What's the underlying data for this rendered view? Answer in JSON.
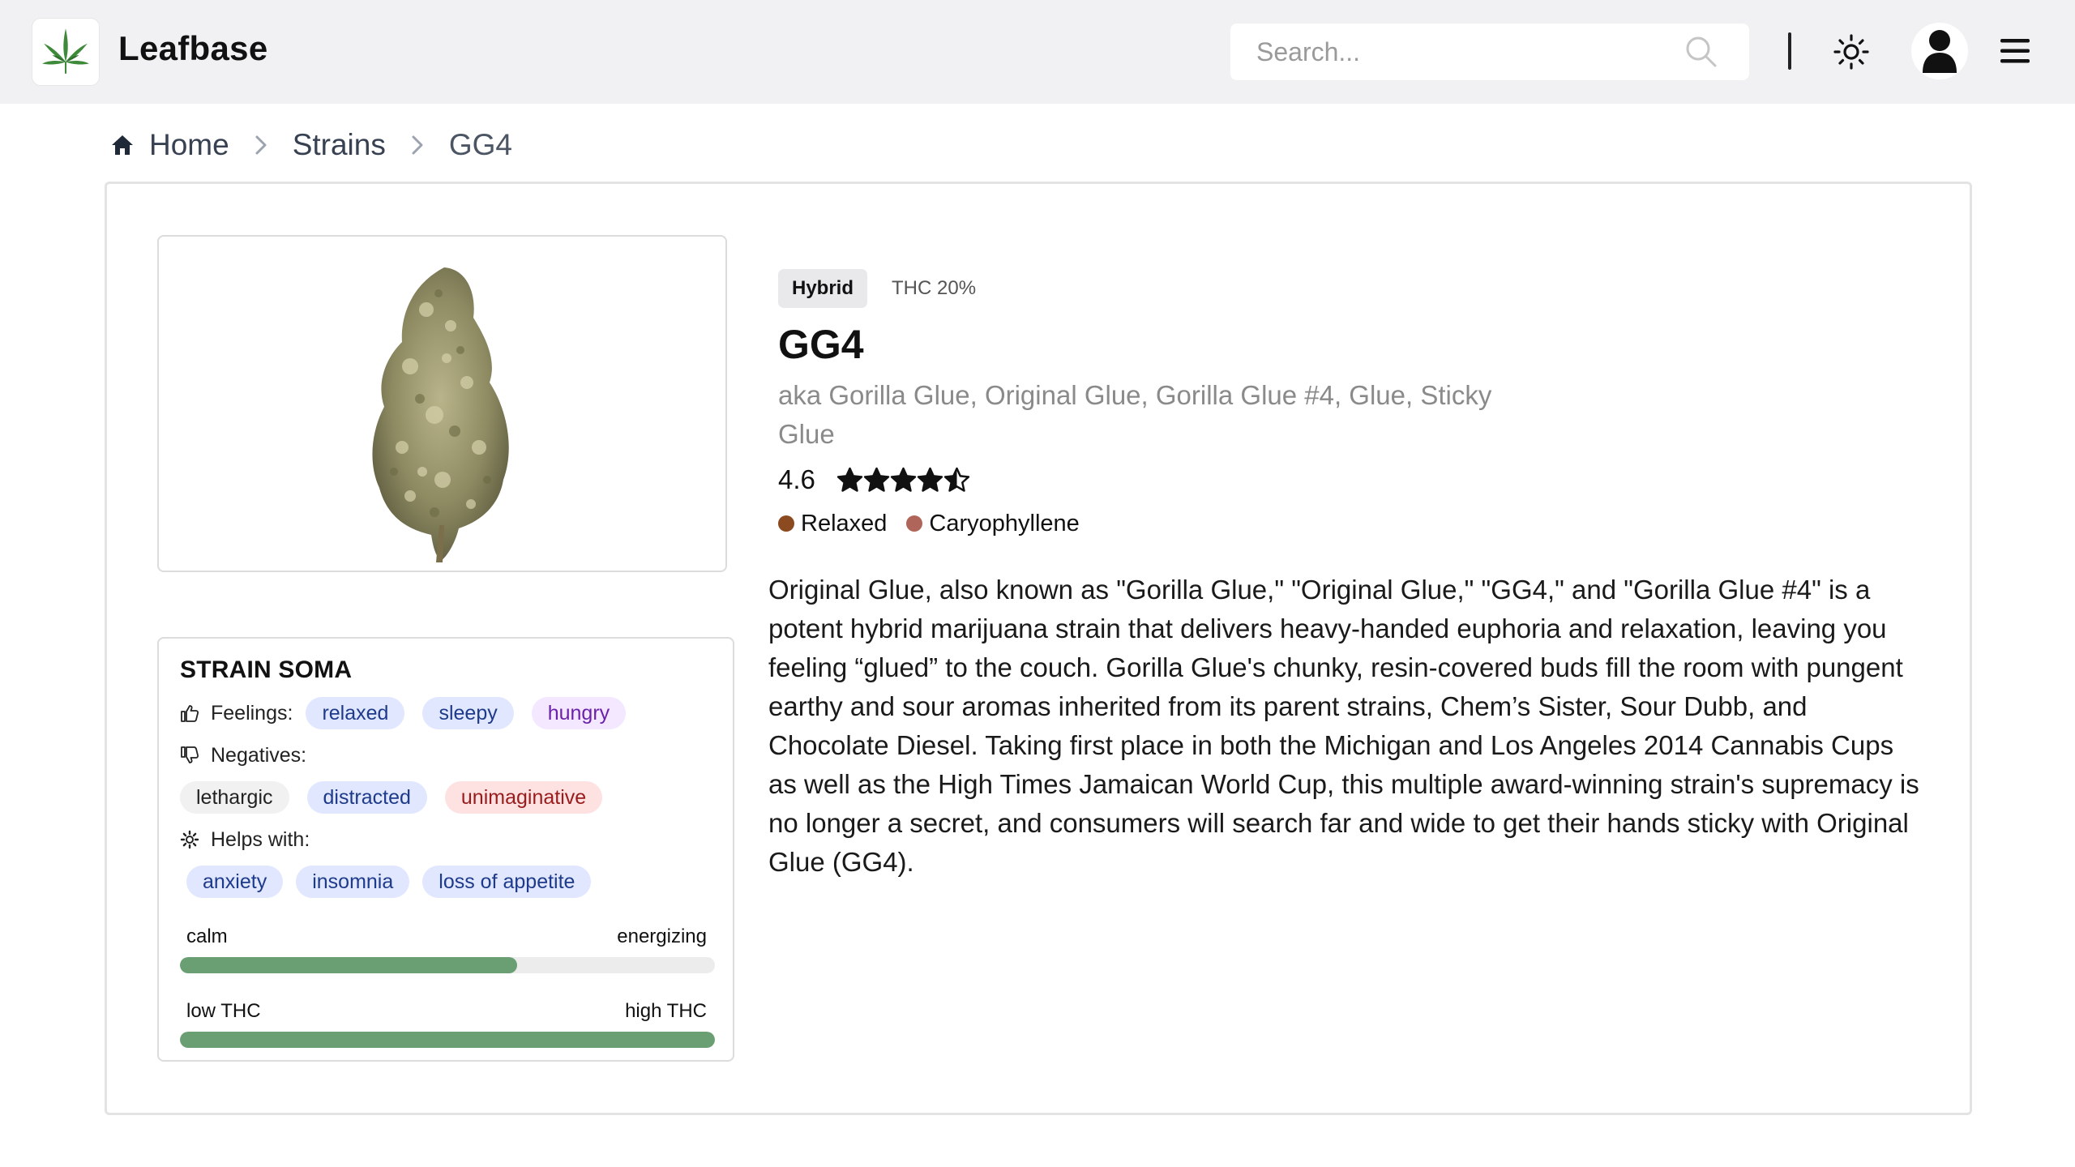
{
  "app": {
    "brand": "Leafbase",
    "search_placeholder": "Search..."
  },
  "breadcrumb": [
    {
      "label": "Home"
    },
    {
      "label": "Strains"
    },
    {
      "label": "GG4"
    }
  ],
  "strain": {
    "type": "Hybrid",
    "thc": "THC 20%",
    "name": "GG4",
    "aka": "aka Gorilla Glue, Original Glue, Gorilla Glue #4, Glue, Sticky Glue",
    "rating": "4.6",
    "rating_value": 4.6,
    "rating_max": 5,
    "tags": [
      {
        "label": "Relaxed",
        "color": "#8b4a1f"
      },
      {
        "label": "Caryophyllene",
        "color": "#b0655a"
      }
    ],
    "description": "Original Glue, also known as \"Gorilla Glue,\" \"Original Glue,\" \"GG4,\" and \"Gorilla Glue #4\" is a potent hybrid marijuana strain that delivers heavy-handed euphoria and relaxation, leaving you feeling “glued” to the couch. Gorilla Glue's chunky, resin-covered buds fill the room with pungent earthy and sour aromas inherited from its parent strains, Chem’s Sister, Sour Dubb, and Chocolate Diesel. Taking first place in both the Michigan and Los Angeles 2014 Cannabis Cups as well as the High Times Jamaican World Cup, this multiple award-winning strain's supremacy is no longer a secret, and consumers will search far and wide to get their hands sticky with Original Glue (GG4)."
  },
  "soma": {
    "title": "STRAIN SOMA",
    "feelings_label": "Feelings:",
    "feelings": [
      "relaxed",
      "sleepy",
      "hungry"
    ],
    "negatives_label": "Negatives:",
    "negatives": [
      "lethargic",
      "distracted",
      "unimaginative"
    ],
    "helps_label": "Helps with:",
    "helps": [
      "anxiety",
      "insomnia",
      "loss of appetite"
    ],
    "scale1": {
      "left": "calm",
      "right": "energizing",
      "value": 0.63
    },
    "scale2": {
      "left": "low THC",
      "right": "high THC",
      "value": 1.0
    }
  },
  "colors": {
    "header_bg": "#f1f1f3",
    "bar_fill": "#6a9f74",
    "chip_blue": "#e0e7ff",
    "chip_purple": "#f3e8ff",
    "chip_red": "#fee2e2"
  },
  "icons": [
    "cannabis-leaf-icon",
    "search-icon",
    "sun-icon",
    "user-icon",
    "menu-icon",
    "home-icon",
    "chevron-right-icon",
    "thumbs-up-icon",
    "thumbs-down-icon",
    "gear-icon",
    "star-icon"
  ]
}
